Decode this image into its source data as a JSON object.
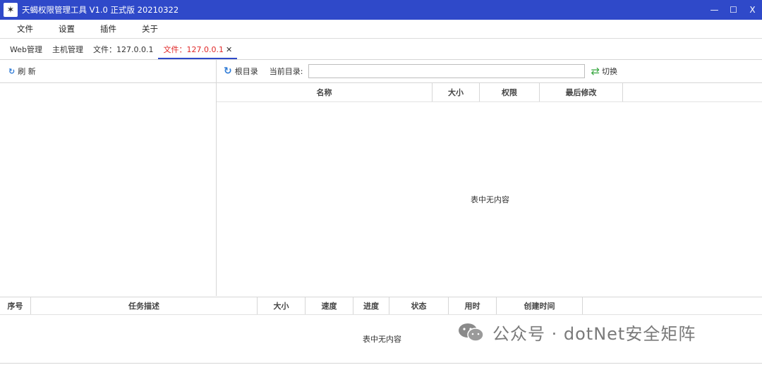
{
  "titlebar": {
    "icon": "app-logo-icon",
    "title": "天蝎权限管理工具 V1.0 正式版 20210322",
    "minimize": "—",
    "maximize": "☐",
    "close": "X"
  },
  "menu": [
    "文件",
    "设置",
    "插件",
    "关于"
  ],
  "tabs": [
    {
      "label": "Web管理"
    },
    {
      "label": "主机管理"
    },
    {
      "label": "文件：127.0.0.1"
    },
    {
      "label": "文件：127.0.0.1",
      "active": true,
      "close": "✕"
    }
  ],
  "left_toolbar": {
    "refresh_label": "刷 新"
  },
  "right_toolbar": {
    "root_label": "根目录",
    "current_dir_label": "当前目录:",
    "path_value": "",
    "switch_label": "切换"
  },
  "file_table": {
    "columns": [
      "名称",
      "大小",
      "权限",
      "最后修改"
    ],
    "empty_text": "表中无内容"
  },
  "task_table": {
    "columns": [
      "序号",
      "任务描述",
      "大小",
      "速度",
      "进度",
      "状态",
      "用时",
      "创建时间"
    ],
    "empty_text": "表中无内容"
  },
  "watermark": {
    "text": "公众号 · dotNet安全矩阵",
    "icon": "wechat-icon"
  },
  "colors": {
    "titlebar": "#2f49c9",
    "active_tab": "#e02828",
    "refresh_icon": "#2f7bd6",
    "switch_icon": "#3aa842"
  }
}
